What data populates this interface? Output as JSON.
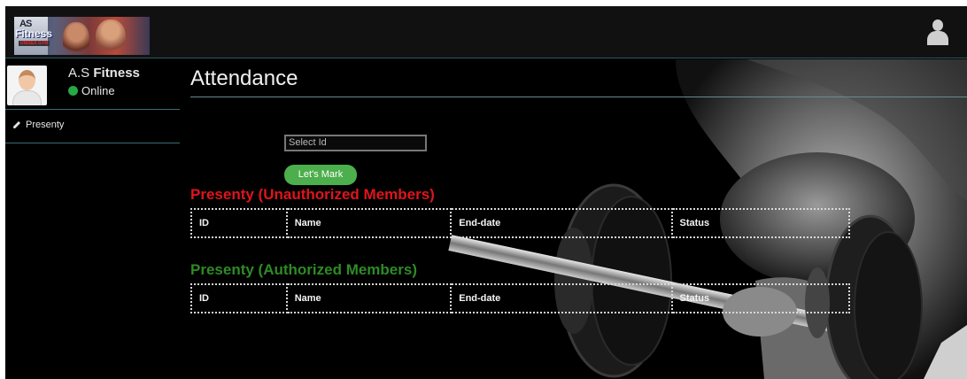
{
  "header": {
    "logo": {
      "top_text": "AS",
      "brand_text": "Fitness",
      "sub_text": "UNISEX GYM"
    },
    "user_icon": "user-icon"
  },
  "sidebar": {
    "profile": {
      "name_prefix": "A.S",
      "name_bold": "Fitness",
      "status": "Online",
      "status_color": "#28a745"
    },
    "items": [
      {
        "label": "Presenty",
        "icon": "pencil-icon"
      }
    ]
  },
  "main": {
    "title": "Attendance",
    "select": {
      "placeholder": "Select Id"
    },
    "mark_button": "Let's Mark",
    "unauthorized": {
      "title": "Presenty (Unauthorized Members)",
      "color": "#e0141c",
      "columns": [
        "ID",
        "Name",
        "End-date",
        "Status"
      ]
    },
    "authorized": {
      "title": "Presenty (Authorized Members)",
      "color": "#2e8b24",
      "columns": [
        "ID",
        "Name",
        "End-date",
        "Status"
      ]
    }
  }
}
